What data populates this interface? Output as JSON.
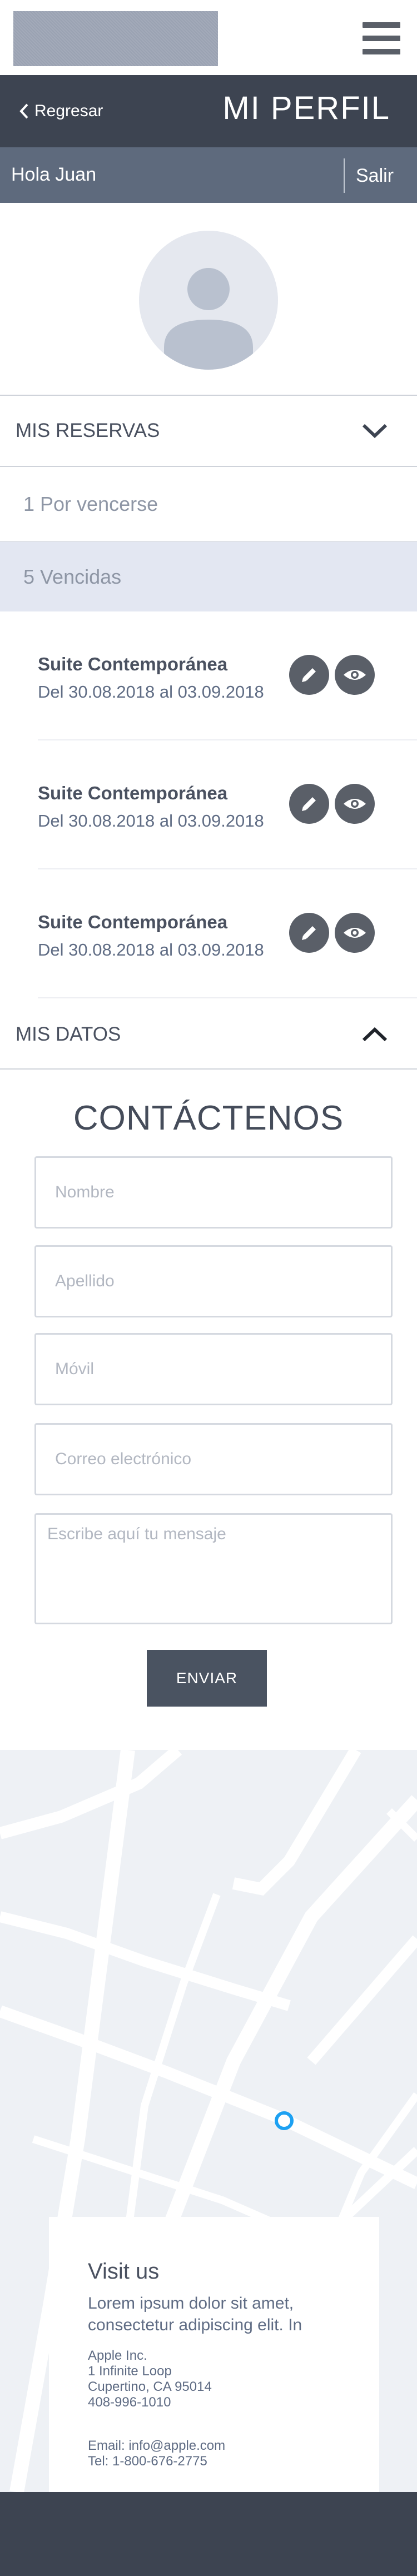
{
  "header": {
    "back_label": "Regresar",
    "page_title": "MI PERFIL"
  },
  "user_bar": {
    "greeting": "Hola Juan",
    "logout_label": "Salir"
  },
  "reservations": {
    "section_label": "MIS RESERVAS",
    "filters": {
      "upcoming": "1 Por vencerse",
      "expired": "5 Vencidas"
    },
    "items": [
      {
        "name": "Suite Contemporánea",
        "dates": "Del 30.08.2018 al 03.09.2018"
      },
      {
        "name": "Suite Contemporánea",
        "dates": "Del 30.08.2018 al 03.09.2018"
      },
      {
        "name": "Suite Contemporánea",
        "dates": "Del 30.08.2018 al 03.09.2018"
      }
    ]
  },
  "my_data": {
    "section_label": "MIS DATOS"
  },
  "contact": {
    "title": "CONTÁCTENOS",
    "fields": {
      "first_name": "Nombre",
      "last_name": "Apellido",
      "mobile": "Móvil",
      "email": "Correo electrónico",
      "message": "Escribe aquí tu mensaje"
    },
    "submit_label": "ENVIAR"
  },
  "visit": {
    "title": "Visit us",
    "lorem": "Lorem ipsum dolor sit amet, consectetur adipiscing elit. In",
    "address_lines": [
      "Apple Inc.",
      "1 Infinite Loop",
      "Cupertino, CA 95014",
      "408-996-1010"
    ],
    "email_line": "Email: info@apple.com",
    "tel_line": "Tel: 1-800-676-2775"
  },
  "colors": {
    "dark_bar": "#3d4451",
    "user_bar": "#5e6a7d",
    "icon_button": "#5a5f68",
    "map_pin": "#1da1f2"
  }
}
